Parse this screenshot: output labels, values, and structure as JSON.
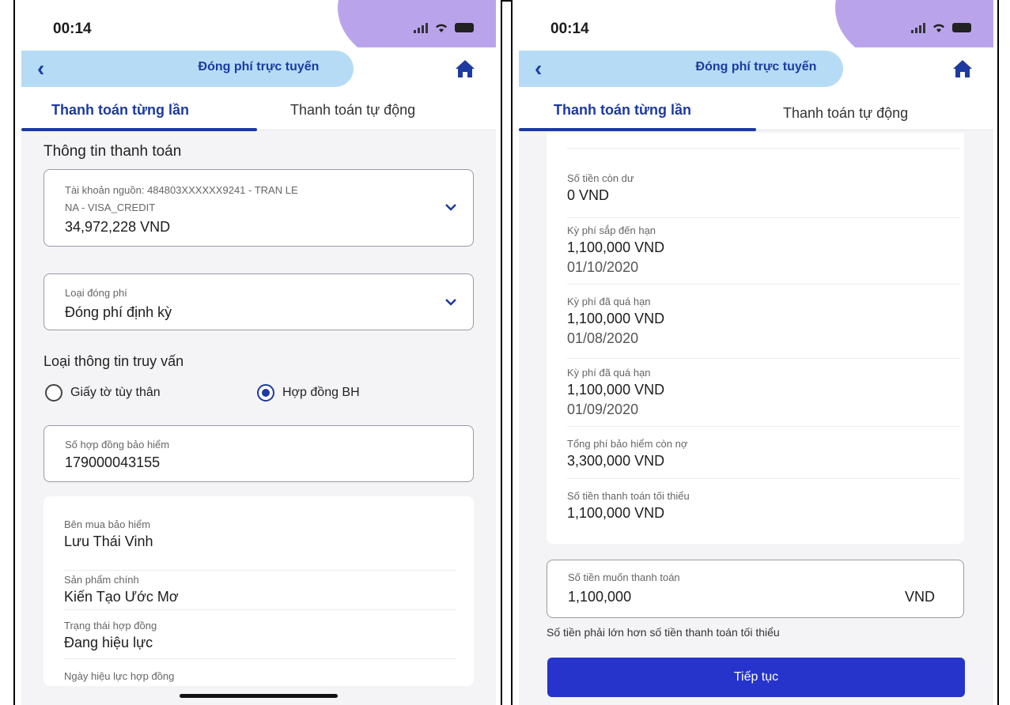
{
  "left": {
    "status": {
      "time": "00:14"
    },
    "header": {
      "title": "Đóng phí trực tuyến"
    },
    "tabs": {
      "active": "Thanh toán từng lần",
      "inactive": "Thanh toán tự động"
    },
    "section_title": "Thông tin thanh toán",
    "source_account": {
      "label_line1": "Tài khoản nguồn: 484803XXXXXX9241 - TRAN LE",
      "label_line2": "NA - VISA_CREDIT",
      "value": "34,972,228 VND"
    },
    "fee_type": {
      "label": "Loại đóng phí",
      "value": "Đóng phí định kỳ"
    },
    "query_type": {
      "title": "Loại thông tin truy vấn",
      "option_id": "Giấy tờ tùy thân",
      "option_contract": "Hợp đồng BH",
      "selected": "Hợp đồng BH"
    },
    "contract_number": {
      "label": "Số hợp đồng bảo hiểm",
      "value": "179000043155"
    },
    "details": {
      "buyer_label": "Bên mua bảo hiểm",
      "buyer_value": "Lưu Thái Vinh",
      "product_label": "Sản phẩm chính",
      "product_value": "Kiến Tạo Ước Mơ",
      "status_label": "Trạng thái hợp đồng",
      "status_value": "Đang hiệu lực",
      "effective_label": "Ngày hiệu lực hợp đồng"
    }
  },
  "right": {
    "status": {
      "time": "00:14"
    },
    "header": {
      "title": "Đóng phí trực tuyến"
    },
    "tabs": {
      "active": "Thanh toán từng lần",
      "inactive": "Thanh toán tự động"
    },
    "details": {
      "remaining_label": "Số tiền còn dư",
      "remaining_value": "0 VND",
      "upcoming_label": "Kỳ phí sắp đến hạn",
      "upcoming_value": "1,100,000 VND",
      "upcoming_date": "01/10/2020",
      "overdue1_label": "Kỳ phí đã quá hạn",
      "overdue1_value": "1,100,000 VND",
      "overdue1_date": "01/08/2020",
      "overdue2_label": "Kỳ phí đã quá hạn",
      "overdue2_value": "1,100,000 VND",
      "overdue2_date": "01/09/2020",
      "debt_label": "Tổng phí bảo hiểm còn nợ",
      "debt_value": "3,300,000 VND",
      "min_label": "Số tiền thanh toán tối thiểu",
      "min_value": "1,100,000 VND"
    },
    "amount": {
      "label": "Số tiền muốn thanh toán",
      "value": "1,100,000",
      "currency": "VND"
    },
    "hint": "Số tiền phải lớn hơn số tiền thanh toán tối thiểu",
    "continue_label": "Tiếp tục"
  },
  "colors": {
    "brand_blue": "#1d3aa0",
    "button_blue": "#2634cc",
    "accent_purple": "#b9a4ec",
    "accent_light_blue": "#b6dcf5"
  }
}
